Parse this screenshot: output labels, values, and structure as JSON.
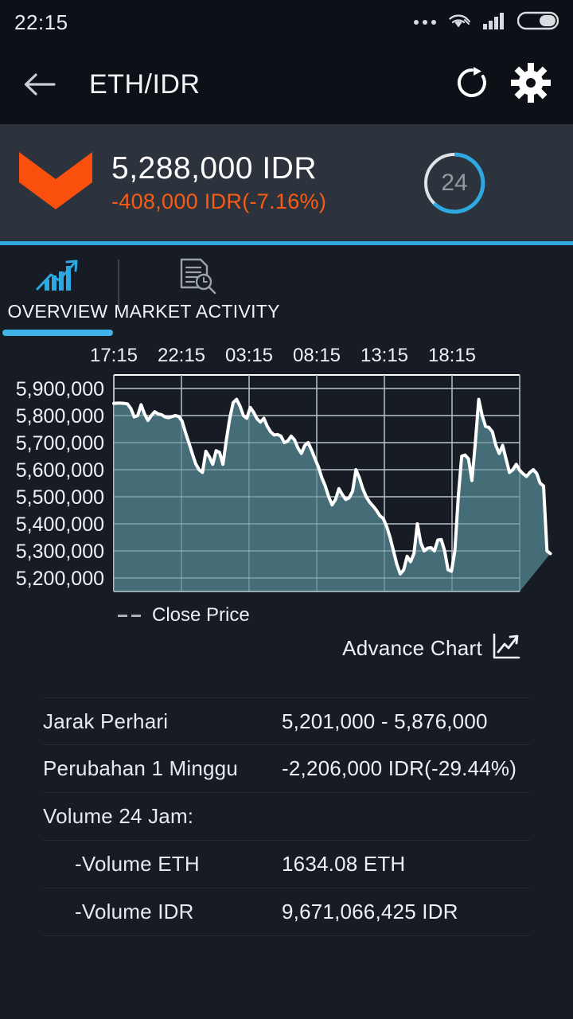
{
  "statusbar": {
    "time": "22:15",
    "icons": [
      "more-dots-icon",
      "wifi-icon",
      "signal-icon",
      "battery-icon"
    ]
  },
  "appbar": {
    "back": "back-arrow-icon",
    "title": "ETH/IDR",
    "refresh": "refresh-icon",
    "settings": "gear-icon"
  },
  "price_header": {
    "trend": "down-chevron-icon",
    "price": "5,288,000 IDR",
    "change": "-408,000 IDR(-7.16%)",
    "countdown": "24",
    "countdown_progress_pct": 75,
    "accent_down": "#f95b14",
    "accent_blue": "#2ea8e0"
  },
  "tabs": [
    {
      "label": "OVERVIEW",
      "icon": "bar-chart-trend-icon",
      "active": true
    },
    {
      "label": "MARKET ACTIVITY",
      "icon": "document-search-icon",
      "active": false
    }
  ],
  "chart_legend": {
    "marker": "dashed-line-marker",
    "label": "Close Price"
  },
  "advance_chart": {
    "label": "Advance Chart",
    "icon": "line-chart-arrow-icon"
  },
  "stats": [
    {
      "label": "Jarak Perhari",
      "value": "5,201,000 - 5,876,000",
      "indent": false
    },
    {
      "label": "Perubahan 1 Minggu",
      "value": "-2,206,000 IDR(-29.44%)",
      "indent": false
    },
    {
      "label": "Volume 24 Jam:",
      "value": "",
      "indent": false
    },
    {
      "label": "-Volume ETH",
      "value": "1634.08 ETH",
      "indent": true
    },
    {
      "label": "-Volume IDR",
      "value": "9,671,066,425 IDR",
      "indent": true
    }
  ],
  "chart_data": {
    "type": "area",
    "title": "",
    "xlabel": "",
    "ylabel": "",
    "series_name": "Close Price",
    "line_color": "#ffffff",
    "fill_color": "#456d77",
    "grid": true,
    "legend_position": "bottom-left",
    "ylim": [
      5150000,
      5950000
    ],
    "ytick_labels": [
      "5,900,000",
      "5,800,000",
      "5,700,000",
      "5,600,000",
      "5,500,000",
      "5,400,000",
      "5,300,000",
      "5,200,000"
    ],
    "yticks": [
      5900000,
      5800000,
      5700000,
      5600000,
      5500000,
      5400000,
      5300000,
      5200000
    ],
    "xtick_labels": [
      "17:15",
      "22:15",
      "03:15",
      "08:15",
      "13:15",
      "18:15"
    ],
    "x": [
      0,
      1,
      2,
      3,
      4,
      5,
      6,
      7,
      8,
      9,
      10,
      11,
      12,
      13,
      14,
      15,
      16,
      17,
      18,
      19,
      20,
      21,
      22,
      23,
      24,
      25,
      26,
      27,
      28,
      29,
      30,
      31,
      32,
      33,
      34,
      35,
      36,
      37,
      38,
      39,
      40,
      41,
      42,
      43,
      44,
      45,
      46,
      47,
      48,
      49,
      50,
      51,
      52,
      53,
      54,
      55,
      56,
      57,
      58,
      59,
      60,
      61,
      62,
      63,
      64,
      65,
      66,
      67,
      68,
      69,
      70,
      71,
      72,
      73,
      74,
      75,
      76,
      77,
      78,
      79,
      80,
      81,
      82,
      83,
      84,
      85,
      86,
      87,
      88,
      89,
      90,
      91,
      92,
      93,
      94,
      95,
      96,
      97,
      98,
      99,
      100,
      101,
      102,
      103,
      104,
      105,
      106,
      107,
      108,
      109,
      110,
      111,
      112,
      113,
      114,
      115,
      116,
      117,
      118,
      119
    ],
    "values": [
      5845000,
      5846000,
      5846000,
      5845000,
      5843000,
      5826000,
      5795000,
      5800000,
      5840000,
      5806000,
      5782000,
      5800000,
      5814000,
      5806000,
      5803000,
      5795000,
      5792000,
      5796000,
      5800000,
      5797000,
      5780000,
      5738000,
      5700000,
      5660000,
      5622000,
      5600000,
      5590000,
      5668000,
      5648000,
      5620000,
      5670000,
      5664000,
      5620000,
      5710000,
      5790000,
      5848000,
      5860000,
      5835000,
      5800000,
      5790000,
      5830000,
      5812000,
      5788000,
      5776000,
      5790000,
      5760000,
      5740000,
      5728000,
      5730000,
      5724000,
      5700000,
      5706000,
      5724000,
      5710000,
      5680000,
      5660000,
      5690000,
      5700000,
      5672000,
      5640000,
      5610000,
      5570000,
      5540000,
      5500000,
      5470000,
      5490000,
      5530000,
      5508000,
      5490000,
      5496000,
      5520000,
      5600000,
      5570000,
      5530000,
      5500000,
      5480000,
      5466000,
      5450000,
      5430000,
      5420000,
      5390000,
      5350000,
      5300000,
      5250000,
      5215000,
      5230000,
      5280000,
      5260000,
      5290000,
      5400000,
      5330000,
      5300000,
      5310000,
      5312000,
      5300000,
      5340000,
      5342000,
      5300000,
      5230000,
      5225000,
      5300000,
      5500000,
      5650000,
      5654000,
      5640000,
      5560000,
      5700000,
      5860000,
      5800000,
      5760000,
      5756000,
      5740000,
      5690000,
      5660000,
      5690000,
      5640000,
      5590000,
      5600000,
      5620000,
      5598000,
      5585000,
      5575000,
      5590000,
      5600000,
      5586000,
      5550000,
      5540000,
      5300000,
      5290000
    ]
  }
}
